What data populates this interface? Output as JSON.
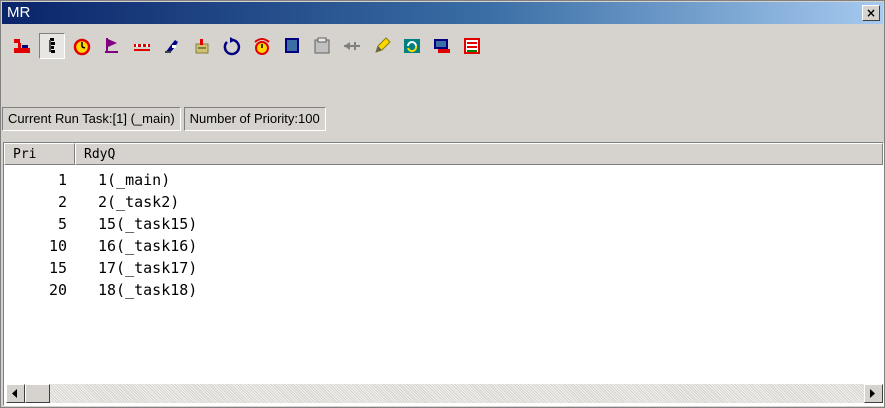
{
  "window": {
    "title": "MR",
    "close_glyph": "×"
  },
  "toolbar": {
    "buttons": [
      {
        "icon": "red-bars-icon",
        "pressed": false
      },
      {
        "icon": "ready-queue-icon",
        "pressed": true
      },
      {
        "icon": "alarm-clock-icon",
        "pressed": false
      },
      {
        "icon": "flag-icon",
        "pressed": false
      },
      {
        "icon": "message-icon",
        "pressed": false
      },
      {
        "icon": "key-icon",
        "pressed": false
      },
      {
        "icon": "mailbox-icon",
        "pressed": false
      },
      {
        "icon": "cycle-icon",
        "pressed": false
      },
      {
        "icon": "alarm-handler-icon",
        "pressed": false
      },
      {
        "icon": "memory-pool-icon",
        "pressed": false
      },
      {
        "icon": "memory-block-icon",
        "pressed": false
      },
      {
        "icon": "port-icon",
        "pressed": false
      },
      {
        "icon": "edit-icon",
        "pressed": false
      },
      {
        "icon": "refresh-icon",
        "pressed": false
      },
      {
        "icon": "display-icon",
        "pressed": false
      },
      {
        "icon": "context-icon",
        "pressed": false
      }
    ]
  },
  "status": {
    "current_run_task": "Current Run Task:[1] (_main)",
    "number_of_priority": "Number of Priority:100"
  },
  "table": {
    "headers": [
      "Pri",
      "RdyQ"
    ],
    "rows": [
      {
        "pri": "1",
        "rdyq": "1(_main)"
      },
      {
        "pri": "2",
        "rdyq": "2(_task2)"
      },
      {
        "pri": "5",
        "rdyq": "15(_task15)"
      },
      {
        "pri": "10",
        "rdyq": "16(_task16)"
      },
      {
        "pri": "15",
        "rdyq": "17(_task17)"
      },
      {
        "pri": "20",
        "rdyq": "18(_task18)"
      }
    ]
  }
}
